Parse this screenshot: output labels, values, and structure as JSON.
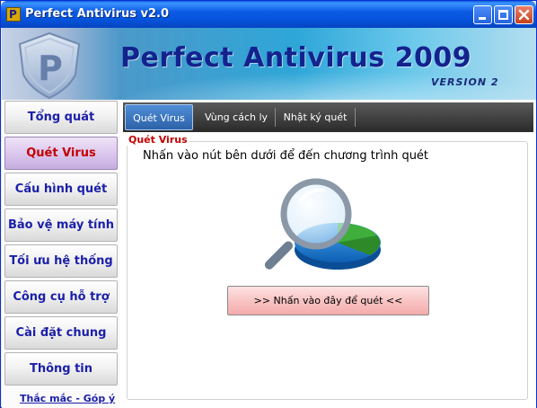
{
  "window": {
    "title": "Perfect Antivirus v2.0",
    "icon_letter": "P",
    "controls": {
      "minimize": "minimize-icon",
      "maximize": "maximize-icon",
      "close": "close-icon"
    }
  },
  "banner": {
    "title": "Perfect Antivirus 2009",
    "version": "VERSION 2",
    "shield_letter": "P"
  },
  "sidebar": {
    "items": [
      {
        "label": "Tổng quát",
        "active": false
      },
      {
        "label": "Quét Virus",
        "active": true
      },
      {
        "label": "Cấu hình quét",
        "active": false
      },
      {
        "label": "Bảo vệ máy tính",
        "active": false
      },
      {
        "label": "Tối ưu hệ thống",
        "active": false
      },
      {
        "label": "Công cụ hỗ trợ",
        "active": false
      },
      {
        "label": "Cài đặt chung",
        "active": false
      },
      {
        "label": "Thông tin",
        "active": false
      }
    ],
    "help_link": "Thắc mắc - Góp ý"
  },
  "tabs": [
    {
      "label": "Quét Virus",
      "active": true
    },
    {
      "label": "Vùng cách ly",
      "active": false
    },
    {
      "label": "Nhật ký quét",
      "active": false
    }
  ],
  "panel": {
    "group_title": "Quét Virus",
    "instruction": "Nhấn vào nút bên dưới để đến chương trình quét",
    "illustration": "magnifier-pie-chart-icon",
    "scan_button": ">> Nhấn vào đây để quét <<"
  },
  "colors": {
    "titlebar": "#0653dc",
    "nav_text": "#1b1fa8",
    "active_red": "#c30000",
    "active_nav_bg": "#dcc8ee",
    "scan_button_bg": "#f9c4c4",
    "tabstrip_bg": "#3a3a3a",
    "active_tab_bg": "#3d78c2"
  }
}
